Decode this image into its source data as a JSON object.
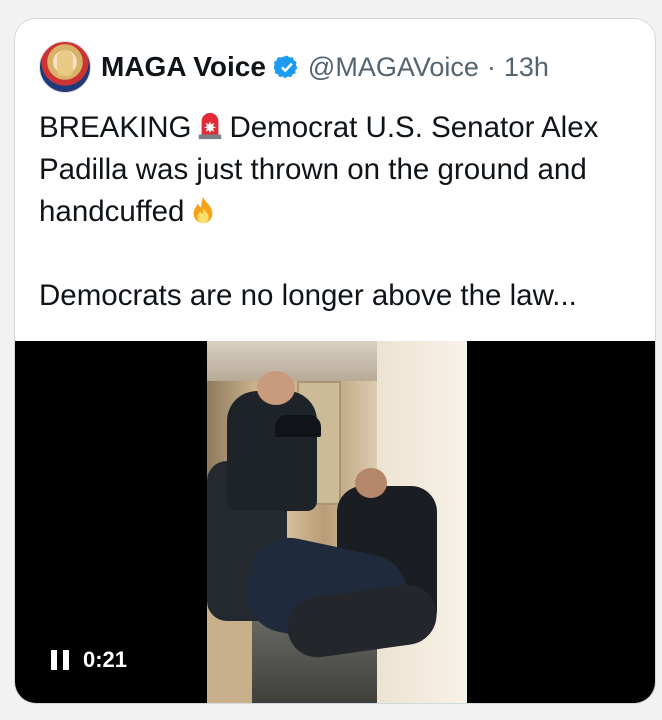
{
  "tweet": {
    "author": {
      "display_name": "MAGA Voice",
      "handle": "@MAGAVoice",
      "separator": "·",
      "time": "13h",
      "verified": true,
      "avatar_icon": "avatar-image"
    },
    "text": {
      "line1_a": "BREAKING",
      "line1_emoji": "police-siren-icon",
      "line1_b": "Democrat U.S. Senator Alex",
      "line2": "Padilla was just thrown on the ground and",
      "line3": "handcuffed",
      "line3_emoji": "fire-icon",
      "line4": "Democrats are no longer above the law..."
    },
    "video": {
      "state": "pause-icon",
      "duration": "0:21"
    }
  },
  "colors": {
    "text": "#0f1419",
    "secondary": "#536471",
    "verified": "#1d9bf0",
    "border": "#cfd9de",
    "video_bg": "#000000"
  }
}
